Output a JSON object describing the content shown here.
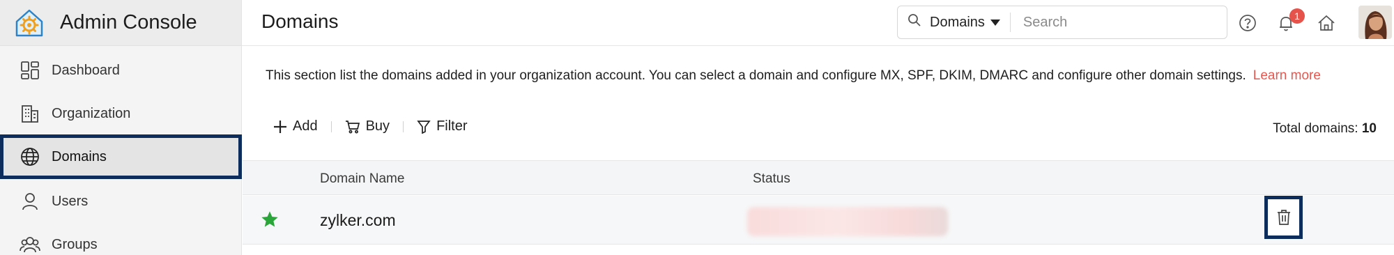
{
  "app": {
    "title": "Admin Console"
  },
  "sidebar": {
    "items": [
      {
        "label": "Dashboard",
        "icon": "dashboard-icon"
      },
      {
        "label": "Organization",
        "icon": "building-icon"
      },
      {
        "label": "Domains",
        "icon": "globe-icon",
        "active": true
      },
      {
        "label": "Users",
        "icon": "user-icon"
      },
      {
        "label": "Groups",
        "icon": "group-icon"
      }
    ]
  },
  "header": {
    "title": "Domains",
    "search_scope": "Domains",
    "search_placeholder": "Search",
    "notification_count": "1",
    "icons": [
      "help-icon",
      "bell-icon",
      "home-icon",
      "avatar"
    ]
  },
  "main": {
    "description": "This section list the domains added in your organization account. You can select a domain and configure MX, SPF, DKIM, DMARC and configure other domain settings.",
    "learn_more": "Learn more",
    "toolbar": {
      "add": "Add",
      "buy": "Buy",
      "filter": "Filter"
    },
    "total_label": "Total domains:",
    "total_value": "10",
    "table": {
      "columns": [
        "Domain Name",
        "Status"
      ],
      "rows": [
        {
          "domain": "zylker.com",
          "primary": true
        }
      ]
    }
  },
  "colors": {
    "accent_border": "#0d2d5c",
    "link": "#e8574f",
    "star": "#2aa53a",
    "badge": "#e5534b"
  }
}
